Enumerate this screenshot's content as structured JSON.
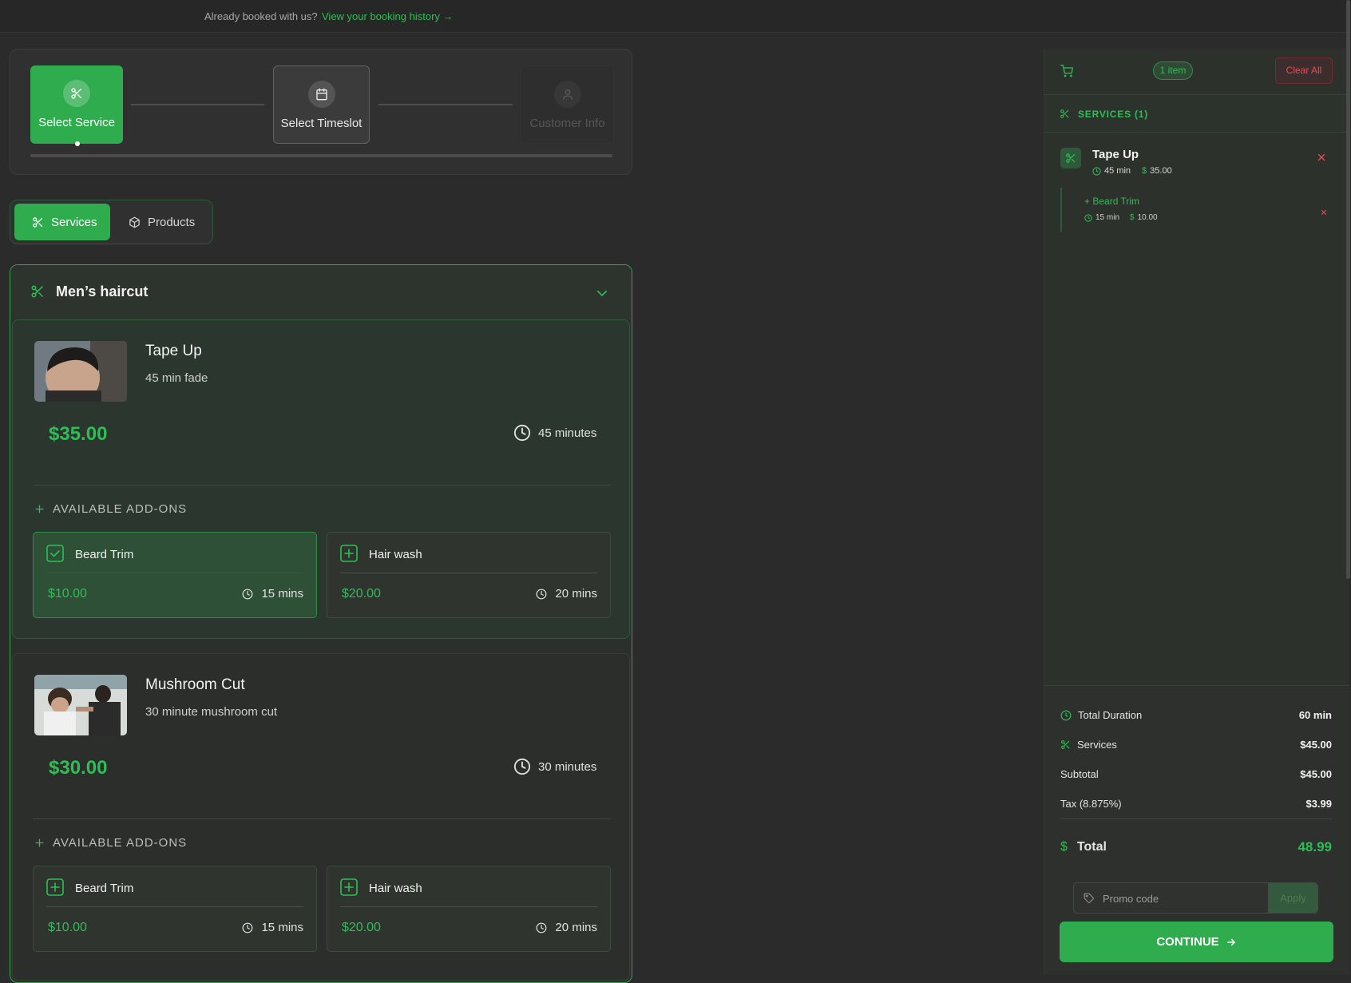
{
  "topbar": {
    "text": "Already booked with us?",
    "link": "View your booking history →"
  },
  "steps": [
    {
      "label": "Select Service",
      "icon": "scissors-icon",
      "state": "active"
    },
    {
      "label": "Select Timeslot",
      "icon": "calendar-icon",
      "state": "next"
    },
    {
      "label": "Customer Info",
      "icon": "user-icon",
      "state": "disabled"
    }
  ],
  "tabs": {
    "services": "Services",
    "products": "Products"
  },
  "category": {
    "title": "Men’s haircut",
    "icon": "scissors-icon"
  },
  "services": [
    {
      "name": "Tape Up",
      "description": "45 min fade",
      "price_symbol": "$",
      "price": "35.00",
      "duration": "45 minutes",
      "addons_title": "AVAILABLE ADD-ONS",
      "addons": [
        {
          "name": "Beard Trim",
          "symbol": "$",
          "price": "10.00",
          "duration": "15 mins",
          "selected": true
        },
        {
          "name": "Hair wash",
          "symbol": "$",
          "price": "20.00",
          "duration": "20 mins",
          "selected": false
        }
      ]
    },
    {
      "name": "Mushroom Cut",
      "description": "30 minute mushroom cut",
      "price_symbol": "$",
      "price": "30.00",
      "duration": "30 minutes",
      "addons_title": "AVAILABLE ADD-ONS",
      "addons": [
        {
          "name": "Beard Trim",
          "symbol": "$",
          "price": "10.00",
          "duration": "15 mins",
          "selected": false
        },
        {
          "name": "Hair wash",
          "symbol": "$",
          "price": "20.00",
          "duration": "20 mins",
          "selected": false
        }
      ]
    }
  ],
  "cart": {
    "badge": "1 item",
    "clear": "Clear All",
    "section": "SERVICES (1)",
    "item": {
      "name": "Tape Up",
      "duration": "45 min",
      "price": "35.00"
    },
    "subitem": {
      "name": "+ Beard Trim",
      "duration": "15 min",
      "price": "10.00"
    },
    "summary": {
      "total_duration_label": "Total Duration",
      "total_duration": "60 min",
      "services_label": "Services",
      "services": "$45.00",
      "subtotal_label": "Subtotal",
      "subtotal": "$45.00",
      "tax_label": "Tax (8.875%)",
      "tax": "$3.99",
      "total_symbol": "$",
      "total_label": "Total",
      "total": "48.99"
    },
    "promo_placeholder": "Promo code",
    "apply": "Apply",
    "continue": "CONTINUE"
  },
  "colors": {
    "accent": "#2fac4d",
    "accent_text": "#2fbe55",
    "danger": "#ea4a55",
    "background": "#2a2b2a"
  }
}
